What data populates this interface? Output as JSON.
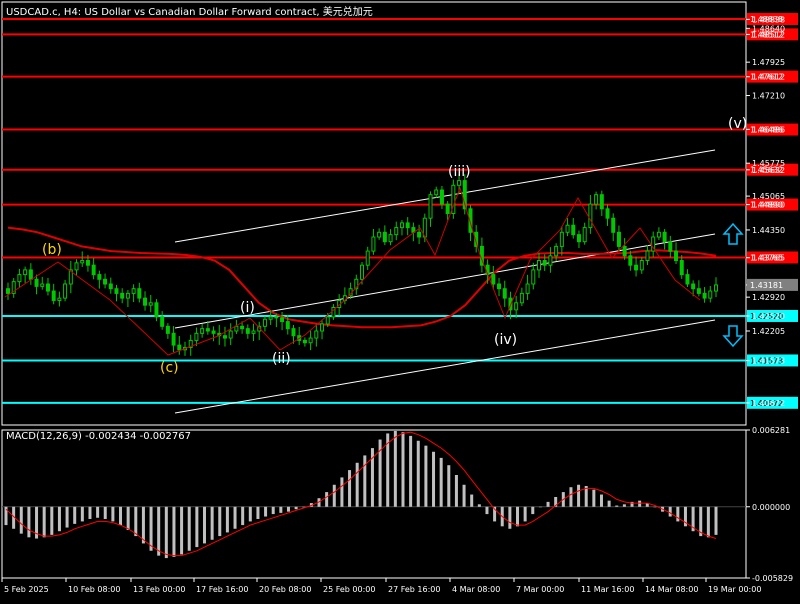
{
  "title": "USDCAD.c, H4:  US Dollar vs Canadian Dollar Forward contract, 美元兑加元",
  "macd_label": "MACD(12,26,9) -0.002434 -0.002767",
  "colors": {
    "background": "#000000",
    "grid_border": "#FFFFFF",
    "candles": "#00C800",
    "ma": "#E00000",
    "resistance": "#FF0000",
    "support": "#00FFFF",
    "channel": "#FFFFFF",
    "wave_zigzag": "#D00000",
    "macd_hist": "#C0C0C0",
    "macd_signal": "#FF0000",
    "label_white": "#FFFFFF",
    "label_yellow": "#FFD700",
    "arrow_up": "#00BFFF",
    "arrow_down": "#00BFFF"
  },
  "chart_data": [
    {
      "type": "candlestick",
      "symbol": "USDCAD.c",
      "timeframe": "H4",
      "ylim": [
        1.402,
        1.492
      ],
      "price_axis_ticks": [
        1.4883,
        1.4864,
        1.4851,
        1.4792,
        1.4761,
        1.4721,
        1.4649,
        1.4577,
        1.4563,
        1.4507,
        1.4489,
        1.4435,
        1.4376,
        1.4318,
        1.4292,
        1.4252,
        1.422,
        1.4157,
        1.4067
      ],
      "price_axis_tick_labels": [
        "1.48838",
        "1.48640",
        "1.48512",
        "1.47925",
        "1.47612",
        "1.47210",
        "1.46486",
        "1.45775",
        "1.45632",
        "1.45065",
        "1.44890",
        "1.44350",
        "1.43765",
        "1.43181",
        "1.42920",
        "1.42520",
        "1.42205",
        "1.41573",
        "1.40672"
      ],
      "x_labels": [
        "5 Feb 2025",
        "10 Feb 08:00",
        "13 Feb 00:00",
        "17 Feb 16:00",
        "20 Feb 08:00",
        "25 Feb 00:00",
        "27 Feb 16:00",
        "4 Mar 08:00",
        "7 Mar 00:00",
        "11 Mar 16:00",
        "14 Mar 08:00",
        "19 Mar 00:00"
      ],
      "current_price": 1.43181,
      "current_price_label": "1.43181",
      "highlighted_levels": [
        {
          "value": 1.48838,
          "label": "1.48838",
          "kind": "resistance"
        },
        {
          "value": 1.48512,
          "label": "1.48512",
          "kind": "resistance"
        },
        {
          "value": 1.47612,
          "label": "1.47612",
          "kind": "resistance"
        },
        {
          "value": 1.46486,
          "label": "1.46486",
          "kind": "resistance"
        },
        {
          "value": 1.45632,
          "label": "1.45632",
          "kind": "resistance"
        },
        {
          "value": 1.4489,
          "label": "1.44890",
          "kind": "resistance"
        },
        {
          "value": 1.43765,
          "label": "1.43765",
          "kind": "resistance"
        },
        {
          "value": 1.4252,
          "label": "1.42520",
          "kind": "support"
        },
        {
          "value": 1.41573,
          "label": "1.41573",
          "kind": "support"
        },
        {
          "value": 1.40672,
          "label": "1.40672",
          "kind": "support"
        }
      ],
      "close_series": [
        1.43,
        1.4325,
        1.434,
        1.435,
        1.433,
        1.4315,
        1.432,
        1.4305,
        1.4285,
        1.429,
        1.432,
        1.435,
        1.4365,
        1.437,
        1.436,
        1.434,
        1.433,
        1.432,
        1.431,
        1.43,
        1.429,
        1.43,
        1.431,
        1.429,
        1.4275,
        1.428,
        1.425,
        1.423,
        1.4215,
        1.419,
        1.418,
        1.4185,
        1.42,
        1.4215,
        1.4225,
        1.422,
        1.4215,
        1.421,
        1.4205,
        1.422,
        1.423,
        1.4225,
        1.4215,
        1.422,
        1.423,
        1.4245,
        1.425,
        1.4248,
        1.424,
        1.4225,
        1.421,
        1.42,
        1.4195,
        1.4205,
        1.422,
        1.4235,
        1.425,
        1.427,
        1.4285,
        1.4295,
        1.431,
        1.433,
        1.436,
        1.439,
        1.442,
        1.443,
        1.441,
        1.4425,
        1.444,
        1.445,
        1.444,
        1.443,
        1.442,
        1.446,
        1.451,
        1.452,
        1.449,
        1.447,
        1.453,
        1.454,
        1.448,
        1.443,
        1.44,
        1.436,
        1.434,
        1.432,
        1.431,
        1.429,
        1.4265,
        1.428,
        1.43,
        1.432,
        1.435,
        1.437,
        1.436,
        1.438,
        1.44,
        1.443,
        1.4445,
        1.4425,
        1.441,
        1.444,
        1.449,
        1.451,
        1.448,
        1.446,
        1.443,
        1.44,
        1.438,
        1.436,
        1.435,
        1.437,
        1.439,
        1.442,
        1.443,
        1.441,
        1.439,
        1.437,
        1.434,
        1.432,
        1.431,
        1.43,
        1.429,
        1.4305,
        1.4318
      ],
      "ma_series": [
        1.444,
        1.4436,
        1.443,
        1.442,
        1.441,
        1.44,
        1.4395,
        1.439,
        1.4388,
        1.4386,
        1.4385,
        1.4384,
        1.4382,
        1.4378,
        1.437,
        1.435,
        1.4315,
        1.428,
        1.4258,
        1.4245,
        1.424,
        1.4235,
        1.4232,
        1.423,
        1.4228,
        1.4228,
        1.4228,
        1.423,
        1.4232,
        1.424,
        1.4252,
        1.4275,
        1.431,
        1.4345,
        1.437,
        1.438,
        1.4385,
        1.4386,
        1.4386,
        1.4384,
        1.4384,
        1.4385,
        1.4386,
        1.439,
        1.4392,
        1.439,
        1.4388,
        1.4385,
        1.438
      ],
      "wave_labels": [
        {
          "label": "(b)",
          "price": 1.439,
          "style": "yellow"
        },
        {
          "label": "(c)",
          "price": 1.4168,
          "style": "yellow"
        },
        {
          "label": "(i)",
          "price": 1.428,
          "style": "white"
        },
        {
          "label": "(ii)",
          "price": 1.4172,
          "style": "white"
        },
        {
          "label": "(iii)",
          "price": 1.4565,
          "style": "white"
        },
        {
          "label": "(iv)",
          "price": 1.422,
          "style": "white"
        },
        {
          "label": "(v)",
          "price": 1.47,
          "style": "white"
        }
      ]
    },
    {
      "type": "bar",
      "name": "MACD(12,26,9)",
      "value_main": -0.002434,
      "value_signal": -0.002767,
      "ylim": [
        -0.005829,
        0.006281
      ],
      "axis_ticks": [
        0.006281,
        0.0,
        -0.005829
      ],
      "axis_tick_labels": [
        "0.006281",
        "0.000000",
        "-0.005829"
      ],
      "histogram": [
        -0.0015,
        -0.0018,
        -0.0022,
        -0.0025,
        -0.0026,
        -0.0025,
        -0.0023,
        -0.002,
        -0.0017,
        -0.0014,
        -0.0012,
        -0.001,
        -0.0009,
        -0.001,
        -0.0012,
        -0.0015,
        -0.0019,
        -0.0024,
        -0.003,
        -0.0036,
        -0.004,
        -0.0042,
        -0.0041,
        -0.0039,
        -0.0036,
        -0.0033,
        -0.003,
        -0.0027,
        -0.0024,
        -0.0021,
        -0.0018,
        -0.0015,
        -0.0012,
        -0.001,
        -0.0008,
        -0.0006,
        -0.0005,
        -0.0004,
        -0.0002,
        0.0,
        0.0003,
        0.0007,
        0.0012,
        0.0018,
        0.0024,
        0.003,
        0.0036,
        0.0042,
        0.0048,
        0.0055,
        0.006,
        0.0062,
        0.0061,
        0.0058,
        0.0054,
        0.005,
        0.0045,
        0.004,
        0.0034,
        0.0026,
        0.0018,
        0.001,
        0.0002,
        -0.0006,
        -0.0012,
        -0.0016,
        -0.0018,
        -0.0016,
        -0.0012,
        -0.0006,
        0.0,
        0.0004,
        0.0008,
        0.0012,
        0.0016,
        0.0018,
        0.0017,
        0.0014,
        0.001,
        0.0005,
        0.0001,
        0.0002,
        0.0004,
        0.0005,
        0.0003,
        0.0,
        -0.0004,
        -0.0008,
        -0.0012,
        -0.0016,
        -0.002,
        -0.0024,
        -0.0025,
        -0.0023
      ],
      "signal": [
        -0.0002,
        -0.0008,
        -0.0014,
        -0.0019,
        -0.0022,
        -0.0024,
        -0.0024,
        -0.0023,
        -0.0021,
        -0.0018,
        -0.0016,
        -0.0014,
        -0.0012,
        -0.0012,
        -0.0013,
        -0.0015,
        -0.0018,
        -0.0022,
        -0.0027,
        -0.0032,
        -0.0036,
        -0.0039,
        -0.004,
        -0.004,
        -0.0038,
        -0.0036,
        -0.0033,
        -0.003,
        -0.0027,
        -0.0024,
        -0.0021,
        -0.0018,
        -0.0015,
        -0.0013,
        -0.0011,
        -0.0009,
        -0.0007,
        -0.0005,
        -0.0003,
        -0.0001,
        0.0001,
        0.0004,
        0.0008,
        0.0012,
        0.0017,
        0.0022,
        0.0028,
        0.0034,
        0.004,
        0.0046,
        0.0052,
        0.0057,
        0.006,
        0.0061,
        0.0059,
        0.0056,
        0.0052,
        0.0048,
        0.0043,
        0.0037,
        0.003,
        0.0022,
        0.0014,
        0.0006,
        -0.0002,
        -0.0008,
        -0.0013,
        -0.0015,
        -0.0015,
        -0.0012,
        -0.0008,
        -0.0004,
        0.0001,
        0.0006,
        0.001,
        0.0013,
        0.0015,
        0.0015,
        0.0013,
        0.001,
        0.0006,
        0.0004,
        0.0003,
        0.0003,
        0.0003,
        0.0001,
        -0.0002,
        -0.0005,
        -0.0009,
        -0.0013,
        -0.0017,
        -0.0021,
        -0.0024,
        -0.0026
      ]
    }
  ]
}
